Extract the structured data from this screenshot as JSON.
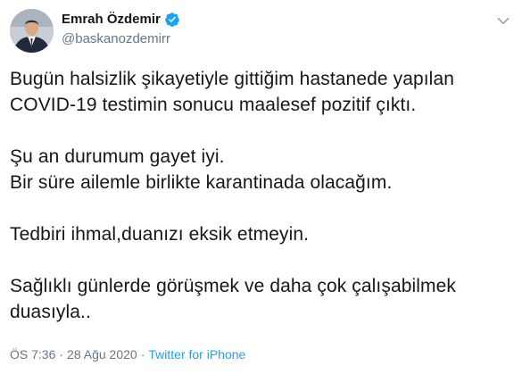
{
  "author": {
    "display_name": "Emrah Özdemir",
    "handle": "@baskanozdemirr",
    "verified": true
  },
  "tweet": {
    "paragraphs": [
      [
        "Bugün halsizlik şikayetiyle gittiğim hastanede yapılan",
        "COVID-19 testimin sonucu maalesef pozitif çıktı."
      ],
      [
        "Şu an durumum gayet iyi.",
        "Bir süre ailemle birlikte karantinada olacağım."
      ],
      [
        "Tedbiri ihmal,duanızı eksik etmeyin."
      ],
      [
        "Sağlıklı günlerde görüşmek ve daha çok çalışabilmek",
        "duasıyla.."
      ]
    ]
  },
  "meta": {
    "time": "ÖS 7:36",
    "separator": "·",
    "date": "28 Ağu 2020",
    "source": "Twitter for iPhone"
  },
  "colors": {
    "accent": "#1da1f2",
    "muted": "#657786",
    "text": "#14171a"
  },
  "icons": {
    "verified": "verified-badge-icon",
    "menu": "chevron-down-icon"
  }
}
